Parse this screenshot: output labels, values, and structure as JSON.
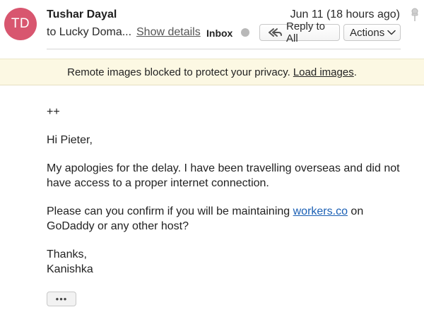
{
  "header": {
    "avatar_initials": "TD",
    "avatar_color": "#d8566f",
    "sender_name": "Tushar Dayal",
    "date": "Jun 11 (18 hours ago)",
    "to_line": "to Lucky Doma...",
    "show_details": "Show details",
    "folder": "Inbox",
    "reply_all_label": "Reply to All",
    "actions_label": "Actions",
    "icons": {
      "pin": "pin-icon",
      "reply_all": "reply-all-icon",
      "actions_chevron": "chevron-down-icon",
      "status_dot": "status-dot"
    }
  },
  "banner": {
    "text": "Remote images blocked to protect your privacy.",
    "link": "Load images",
    "suffix": ".",
    "background": "#fcf8e3"
  },
  "message": {
    "line1": "++",
    "greeting": "Hi Pieter,",
    "para1": "My apologies for the delay. I have been travelling overseas and did not have access to a proper internet connection.",
    "para2_before": "Please can you confirm if you will be maintaining ",
    "para2_link": "workers.co",
    "para2_after": " on GoDaddy or any other host?",
    "signoff": "Thanks,",
    "signature": "Kanishka",
    "link_color": "#1a5fb4"
  },
  "footer": {
    "more_label": "•••"
  }
}
